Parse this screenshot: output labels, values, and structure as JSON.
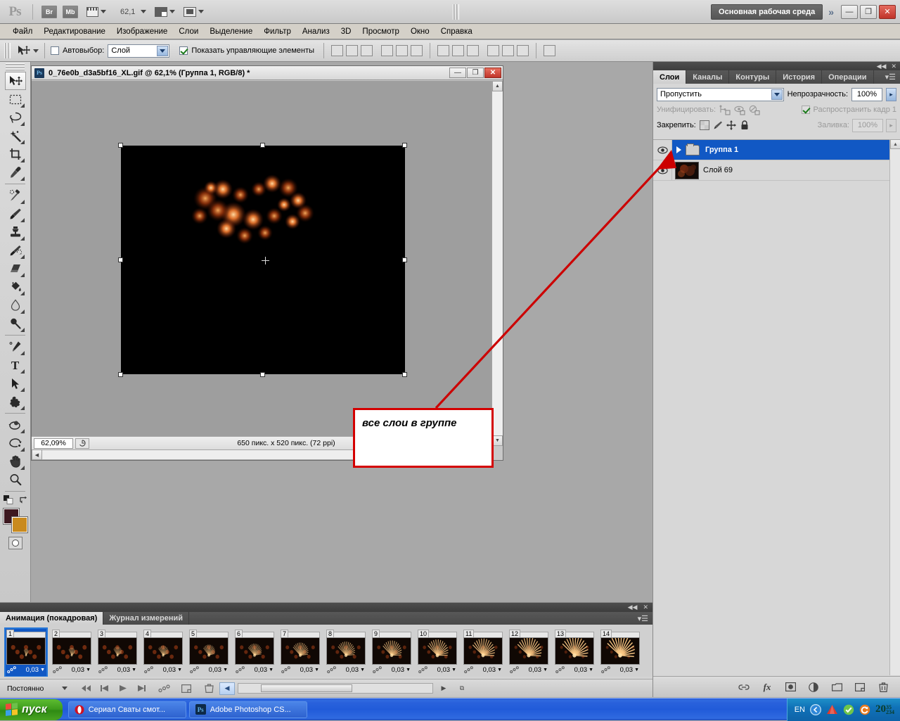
{
  "app": {
    "logo": "Ps",
    "bridge_label": "Br",
    "minibridge_label": "Mb",
    "zoom_level": "62,1",
    "workspace_label": "Основная рабочая среда",
    "more_chevron": "»",
    "minimize": "—",
    "restore": "❐",
    "close": "✕"
  },
  "menubar": {
    "items": [
      {
        "label": "Файл"
      },
      {
        "label": "Редактирование"
      },
      {
        "label": "Изображение"
      },
      {
        "label": "Слои"
      },
      {
        "label": "Выделение"
      },
      {
        "label": "Фильтр"
      },
      {
        "label": "Анализ"
      },
      {
        "label": "3D"
      },
      {
        "label": "Просмотр"
      },
      {
        "label": "Окно"
      },
      {
        "label": "Справка"
      }
    ]
  },
  "options_bar": {
    "autoselect_label": "Автовыбор:",
    "autoselect_checked": false,
    "autoselect_value": "Слой",
    "show_controls_label": "Показать управляющие элементы",
    "show_controls_checked": true,
    "align_icons": [
      "align-top-edges-icon",
      "align-vertical-centers-icon",
      "align-bottom-edges-icon",
      "align-left-edges-icon",
      "align-horizontal-centers-icon",
      "align-right-edges-icon",
      "distribute-top-edges-icon",
      "distribute-vertical-centers-icon",
      "distribute-bottom-edges-icon",
      "distribute-left-edges-icon",
      "distribute-horizontal-centers-icon",
      "distribute-right-edges-icon",
      "auto-align-layers-icon"
    ]
  },
  "toolbox": {
    "tools": [
      {
        "name": "move-tool",
        "selected": true
      },
      {
        "name": "rectangular-marquee-tool",
        "selected": false
      },
      {
        "name": "lasso-tool",
        "selected": false
      },
      {
        "name": "magic-wand-tool",
        "selected": false
      },
      {
        "name": "crop-tool",
        "selected": false
      },
      {
        "name": "eyedropper-tool",
        "selected": false
      },
      {
        "name": "spot-healing-brush-tool",
        "selected": false
      },
      {
        "name": "brush-tool",
        "selected": false
      },
      {
        "name": "clone-stamp-tool",
        "selected": false
      },
      {
        "name": "history-brush-tool",
        "selected": false
      },
      {
        "name": "eraser-tool",
        "selected": false
      },
      {
        "name": "gradient-tool",
        "selected": false
      },
      {
        "name": "blur-tool",
        "selected": false
      },
      {
        "name": "dodge-tool",
        "selected": false
      },
      {
        "name": "pen-tool",
        "selected": false
      },
      {
        "name": "horizontal-type-tool",
        "selected": false
      },
      {
        "name": "path-selection-tool",
        "selected": false
      },
      {
        "name": "custom-shape-tool",
        "selected": false
      },
      {
        "name": "3d-rotate-tool",
        "selected": false
      },
      {
        "name": "3d-orbit-tool",
        "selected": false
      },
      {
        "name": "hand-tool",
        "selected": false
      },
      {
        "name": "zoom-tool",
        "selected": false
      }
    ],
    "foreground_color": "#3d1820",
    "background_color": "#c98a1e",
    "type_tool_glyph": "T"
  },
  "document": {
    "title": "0_76e0b_d3a5bf16_XL.gif @ 62,1% (Группа 1, RGB/8) *",
    "minimize": "—",
    "restore": "❐",
    "close": "✕",
    "status_zoom": "62,09%",
    "status_size": "650 пикс. x 520 пикс. (72 ppi)"
  },
  "callout": {
    "text": "все слои в группе",
    "border_color": "#d40000",
    "arrow_color": "#cc0000"
  },
  "layers_panel": {
    "tabs": [
      {
        "label": "Слои",
        "active": true
      },
      {
        "label": "Каналы",
        "active": false
      },
      {
        "label": "Контуры",
        "active": false
      },
      {
        "label": "История",
        "active": false
      },
      {
        "label": "Операции",
        "active": false
      }
    ],
    "menu_glyph": "▾☰",
    "collapse_glyph": "◀◀",
    "close_glyph": "✕",
    "blend_mode": "Пропустить",
    "opacity_label": "Непрозрачность:",
    "opacity_value": "100%",
    "unify_label": "Унифицировать:",
    "propagate_label": "Распространить кадр 1",
    "propagate_checked": true,
    "lock_label": "Закрепить:",
    "fill_label": "Заливка:",
    "fill_value": "100%",
    "lock_icons": [
      "lock-transparent-pixels-icon",
      "lock-image-pixels-icon",
      "lock-position-icon",
      "lock-all-icon"
    ],
    "unify_icons": [
      "unify-position-icon",
      "unify-visibility-icon",
      "unify-style-icon"
    ],
    "layers": [
      {
        "name": "Группа 1",
        "type": "group",
        "selected": true,
        "visible": true,
        "expanded": false
      },
      {
        "name": "Слой 69",
        "type": "pixel",
        "selected": false,
        "visible": true
      }
    ],
    "bottom_icons": [
      "link-layers-icon",
      "layer-style-icon",
      "layer-mask-icon",
      "adjustment-layer-icon",
      "new-group-icon",
      "new-layer-icon",
      "delete-layer-icon"
    ]
  },
  "animation_panel": {
    "tabs": [
      {
        "label": "Анимация (покадровая)",
        "active": true
      },
      {
        "label": "Журнал измерений",
        "active": false
      }
    ],
    "menu_glyph": "▾☰",
    "collapse_glyph": "◀◀",
    "close_glyph": "✕",
    "loop_option": "Постоянно",
    "controls": [
      "select-first-frame-icon",
      "select-previous-frame-icon",
      "play-animation-icon",
      "select-next-frame-icon",
      "tween-frames-icon",
      "duplicate-frame-icon",
      "delete-frame-icon",
      "convert-to-timeline-icon"
    ],
    "frames": [
      {
        "number": "1",
        "delay": "0,03",
        "selected": true
      },
      {
        "number": "2",
        "delay": "0,03",
        "selected": false
      },
      {
        "number": "3",
        "delay": "0,03",
        "selected": false
      },
      {
        "number": "4",
        "delay": "0,03",
        "selected": false
      },
      {
        "number": "5",
        "delay": "0,03",
        "selected": false
      },
      {
        "number": "6",
        "delay": "0,03",
        "selected": false
      },
      {
        "number": "7",
        "delay": "0,03",
        "selected": false
      },
      {
        "number": "8",
        "delay": "0,03",
        "selected": false
      },
      {
        "number": "9",
        "delay": "0,03",
        "selected": false
      },
      {
        "number": "10",
        "delay": "0,03",
        "selected": false
      },
      {
        "number": "11",
        "delay": "0,03",
        "selected": false
      },
      {
        "number": "12",
        "delay": "0,03",
        "selected": false
      },
      {
        "number": "13",
        "delay": "0,03",
        "selected": false
      },
      {
        "number": "14",
        "delay": "0,03",
        "selected": false
      }
    ]
  },
  "taskbar": {
    "start_label": "пуск",
    "tasks": [
      {
        "label": "Сериал Сваты смот...",
        "icon": "opera-icon"
      },
      {
        "label": "Adobe Photoshop CS...",
        "icon": "photoshop-icon"
      }
    ],
    "language": "EN",
    "tray_icons": [
      "show-hidden-icon",
      "avast-icon",
      "checkmark-icon",
      "update-icon"
    ],
    "clock": "20",
    "clock_sub_top": "35",
    "clock_sub_bottom": "234"
  }
}
